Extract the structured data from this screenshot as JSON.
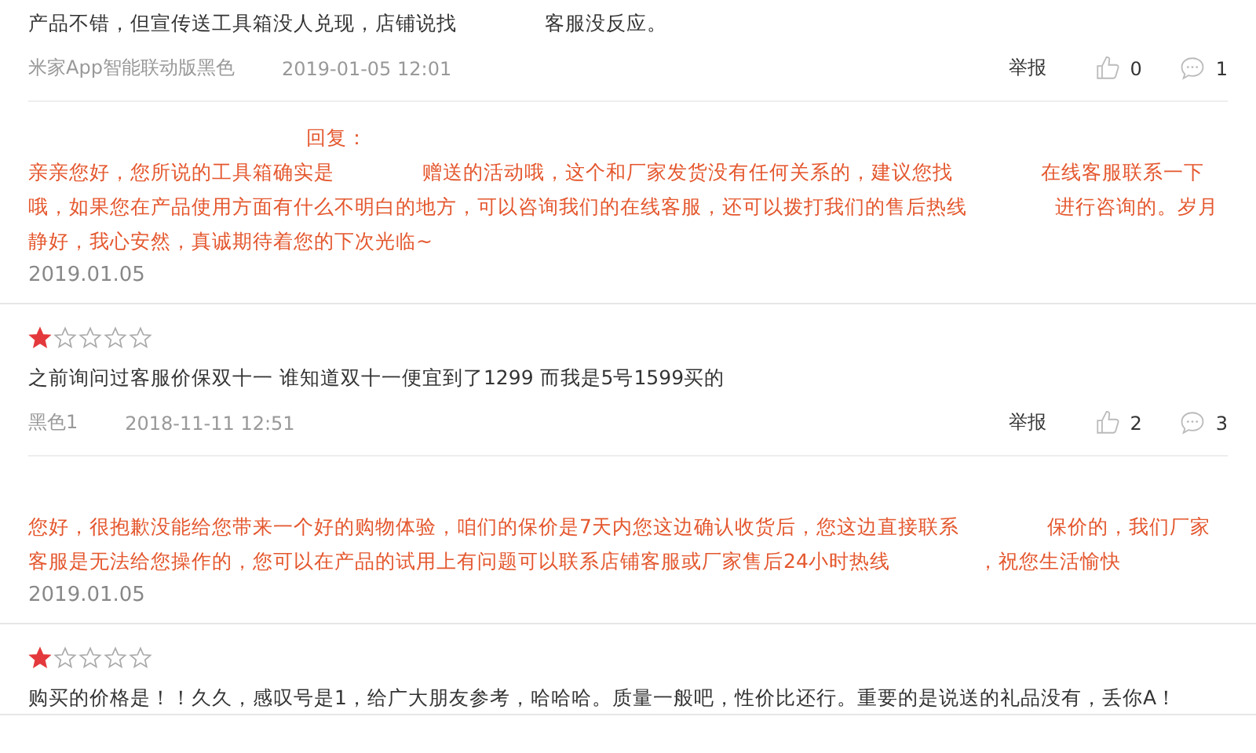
{
  "reviews": [
    {
      "comment": [
        "产品不错，但宣传送工具箱没人兑现，店铺说找",
        "客服没反应。"
      ],
      "variant": "米家App智能联动版黑色",
      "time": "2019-01-05 12:01",
      "report": "举报",
      "likes": "0",
      "replies_count": "1",
      "reply": {
        "label": "回复：",
        "text": [
          "亲亲您好，您所说的工具箱确实是",
          "赠送的活动哦，这个和厂家发货没有任何关系的，建议您找",
          "在线客服联系一下哦，如果您在产品使用方面有什么不明白的地方，可以咨询我们的在线客服，还可以拨打我们的售后热线",
          "进行咨询的。岁月静好，我心安然，真诚期待着您的下次光临~"
        ],
        "date": "2019.01.05"
      }
    },
    {
      "stars": 1,
      "comment": [
        "之前询问过客服价保双十一 谁知道双十一便宜到了1299 而我是5号1599买的"
      ],
      "variant": "黑色1",
      "time": "2018-11-11 12:51",
      "report": "举报",
      "likes": "2",
      "replies_count": "3",
      "reply": {
        "text": [
          "您好，很抱歉没能给您带来一个好的购物体验，咱们的保价是7天内您这边确认收货后，您这边直接联系",
          "保价的，我们厂家客服是无法给您操作的，您可以在产品的试用上有问题可以联系店铺客服或厂家售后24小时热线",
          "，祝您生活愉快"
        ],
        "date": "2019.01.05"
      }
    },
    {
      "stars": 1,
      "comment": [
        "购买的价格是！！久久，感叹号是1，给广大朋友参考，哈哈哈。质量一般吧，性价比还行。重要的是说送的礼品没有，丢你A！"
      ]
    }
  ]
}
